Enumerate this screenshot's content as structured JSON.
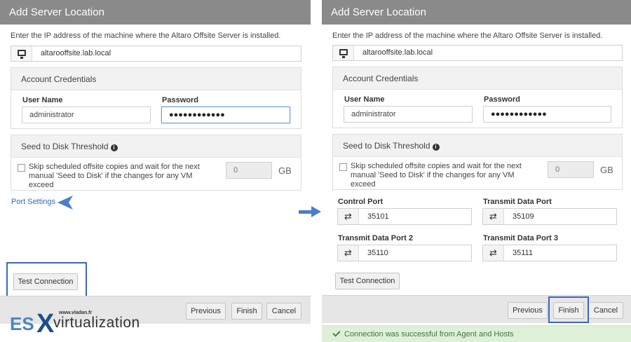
{
  "left": {
    "title": "Add Server Location",
    "description": "Enter the IP address of the machine where the Altaro Offsite Server is installed.",
    "host": "altarooffsite.lab.local",
    "credentials": {
      "heading": "Account Credentials",
      "username_label": "User Name",
      "username_value": "administrator",
      "password_label": "Password",
      "password_value": "●●●●●●●●●●●●"
    },
    "seed": {
      "heading": "Seed to Disk Threshold",
      "checkbox_text": "Skip scheduled offsite copies and wait for the next manual 'Seed to Disk' if the changes for any VM exceed",
      "value": "0",
      "unit": "GB"
    },
    "port_settings_link": "Port Settings",
    "test_connection": "Test Connection",
    "previous": "Previous",
    "finish": "Finish",
    "cancel": "Cancel"
  },
  "right": {
    "title": "Add Server Location",
    "description": "Enter the IP address of the machine where the Altaro Offsite Server is installed.",
    "host": "altarooffsite.lab.local",
    "credentials": {
      "heading": "Account Credentials",
      "username_label": "User Name",
      "username_value": "administrator",
      "password_label": "Password",
      "password_value": "●●●●●●●●●●●●"
    },
    "seed": {
      "heading": "Seed to Disk Threshold",
      "checkbox_text": "Skip scheduled offsite copies and wait for the next manual 'Seed to Disk' if the changes for any VM exceed",
      "value": "0",
      "unit": "GB"
    },
    "ports": [
      {
        "label": "Control Port",
        "value": "35101"
      },
      {
        "label": "Transmit Data Port",
        "value": "35109"
      },
      {
        "label": "Transmit Data Port 2",
        "value": "35110"
      },
      {
        "label": "Transmit Data Port 3",
        "value": "35111"
      }
    ],
    "test_connection": "Test Connection",
    "previous": "Previous",
    "finish": "Finish",
    "cancel": "Cancel",
    "success_message": "Connection was successful from Agent and Hosts"
  },
  "watermark": {
    "brand_es": "ES",
    "brand_x": "X",
    "brand_word": "virtualization",
    "url": "www.vladan.fr"
  },
  "colors": {
    "titlebar": "#8a8a8a",
    "highlight": "#3a67c0",
    "link": "#2f6fb3",
    "success_bg": "#dff0d8",
    "success_text": "#3c763d"
  },
  "icons": [
    "monitor-icon",
    "info-icon",
    "swap-arrows-icon",
    "check-icon",
    "blue-arrow-icon"
  ]
}
